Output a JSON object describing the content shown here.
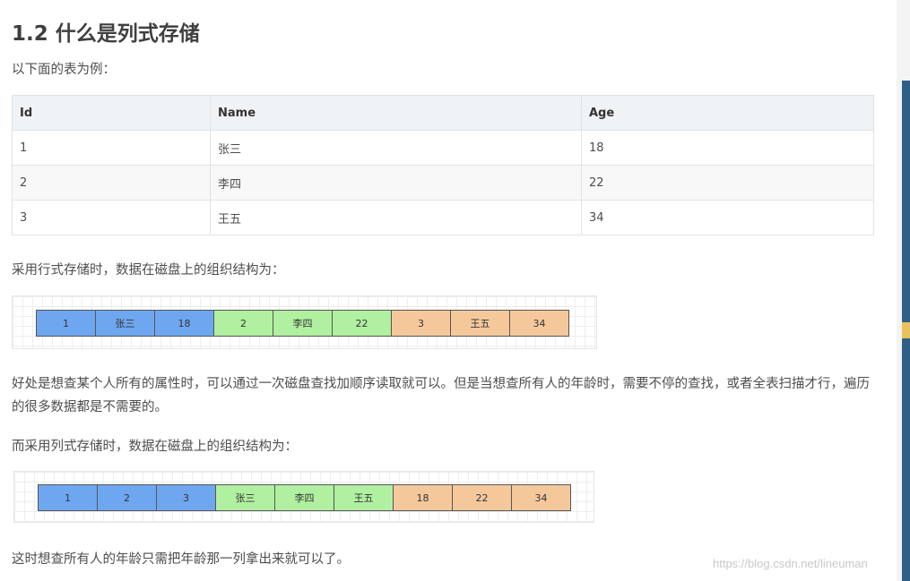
{
  "heading": "1.2 什么是列式存储",
  "intro": "以下面的表为例：",
  "table": {
    "headers": [
      "Id",
      "Name",
      "Age"
    ],
    "rows": [
      [
        "1",
        "张三",
        "18"
      ],
      [
        "2",
        "李四",
        "22"
      ],
      [
        "3",
        "王五",
        "34"
      ]
    ]
  },
  "row_storage_text": "采用行式存储时，数据在磁盘上的组织结构为：",
  "row_storage_cells": [
    {
      "label": "1",
      "color": "blue"
    },
    {
      "label": "张三",
      "color": "blue"
    },
    {
      "label": "18",
      "color": "blue"
    },
    {
      "label": "2",
      "color": "green"
    },
    {
      "label": "李四",
      "color": "green"
    },
    {
      "label": "22",
      "color": "green"
    },
    {
      "label": "3",
      "color": "orange"
    },
    {
      "label": "王五",
      "color": "orange"
    },
    {
      "label": "34",
      "color": "orange"
    }
  ],
  "row_storage_explanation": "好处是想查某个人所有的属性时，可以通过一次磁盘查找加顺序读取就可以。但是当想查所有人的年龄时，需要不停的查找，或者全表扫描才行，遍历的很多数据都是不需要的。",
  "column_storage_text": "而采用列式存储时，数据在磁盘上的组织结构为：",
  "column_storage_cells": [
    {
      "label": "1",
      "color": "blue"
    },
    {
      "label": "2",
      "color": "blue"
    },
    {
      "label": "3",
      "color": "blue"
    },
    {
      "label": "张三",
      "color": "green"
    },
    {
      "label": "李四",
      "color": "green"
    },
    {
      "label": "王五",
      "color": "green"
    },
    {
      "label": "18",
      "color": "orange"
    },
    {
      "label": "22",
      "color": "orange"
    },
    {
      "label": "34",
      "color": "orange"
    }
  ],
  "column_storage_explanation": "这时想查所有人的年龄只需把年龄那一列拿出来就可以了。",
  "watermark": "https://blog.csdn.net/lineuman",
  "colors": {
    "blue": "#6ea7ef",
    "green": "#b0f0a0",
    "orange": "#f5c89c",
    "table_header_bg": "#eff3f5"
  }
}
